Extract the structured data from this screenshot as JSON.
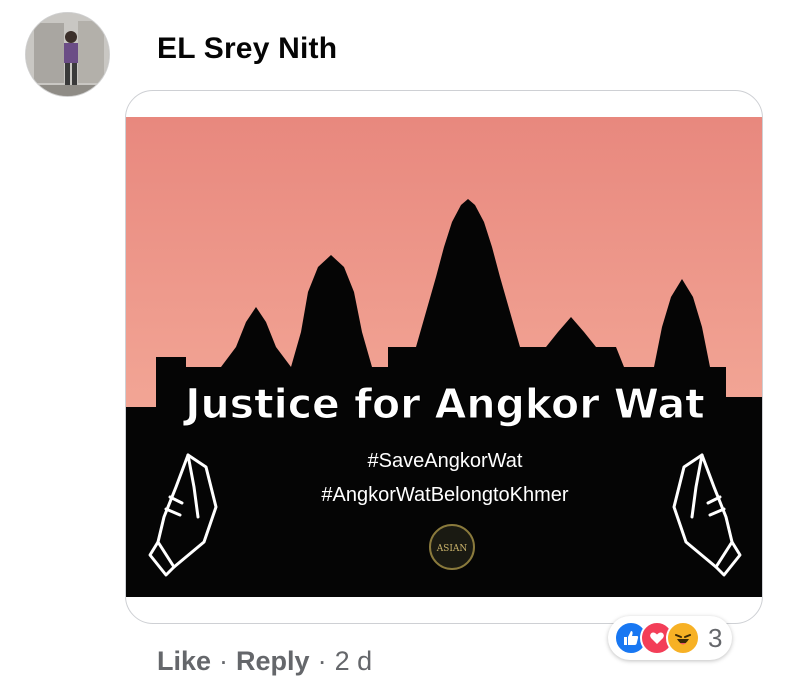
{
  "comment": {
    "author": "EL Srey Nith",
    "avatar_icon": "profile-photo",
    "attachment": {
      "headline": "Justice for Angkor Wat",
      "hashtag1": "#SaveAngkorWat",
      "hashtag2": "#AngkorWatBelongtoKhmer",
      "badge": "ASIAN",
      "left_icon": "praying-hands-icon",
      "right_icon": "praying-hands-icon",
      "colors": {
        "sky_top": "#e98a80",
        "sky_bottom": "#f0a394",
        "silhouette": "#000000"
      }
    },
    "actions": {
      "like": "Like",
      "sep1": "·",
      "reply": "Reply",
      "sep2": "·",
      "time": "2 d"
    },
    "reactions": {
      "icons": [
        "like-icon",
        "love-icon",
        "haha-icon"
      ],
      "count": "3",
      "colors": {
        "like": "#1877f2",
        "love": "#f33e58",
        "haha": "#f7b125"
      }
    }
  }
}
